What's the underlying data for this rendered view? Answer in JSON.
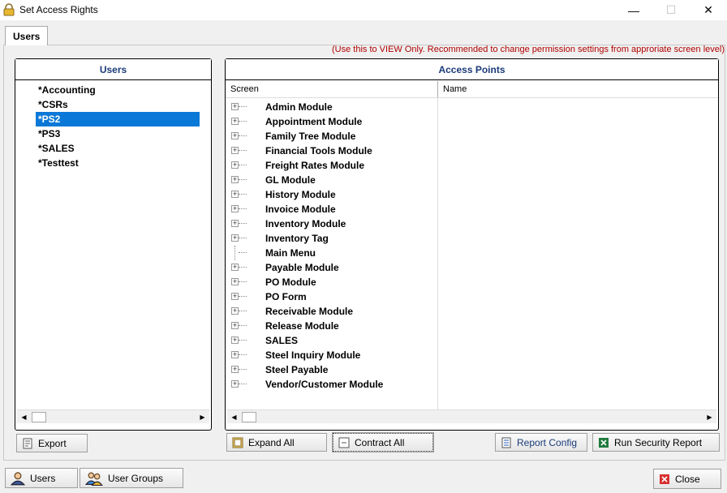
{
  "window": {
    "title": "Set Access Rights",
    "minimize": "—",
    "maximize": "☐",
    "close": "✕"
  },
  "tab": {
    "label": "Users"
  },
  "notice": "(Use this to VIEW Only. Recommended to change permission settings from approriate screen level)",
  "users_panel": {
    "title": "Users",
    "items": [
      "*Accounting",
      "*CSRs",
      "*PS2",
      "*PS3",
      "*SALES",
      "*Testtest"
    ],
    "selected": "*PS2"
  },
  "access_panel": {
    "title": "Access Points",
    "columns": [
      "Screen",
      "Name"
    ],
    "modules": [
      {
        "label": "Admin Module",
        "expandable": true
      },
      {
        "label": "Appointment Module",
        "expandable": true
      },
      {
        "label": "Family Tree Module",
        "expandable": true
      },
      {
        "label": "Financial Tools Module",
        "expandable": true
      },
      {
        "label": "Freight Rates Module",
        "expandable": true
      },
      {
        "label": "GL Module",
        "expandable": true
      },
      {
        "label": "History Module",
        "expandable": true
      },
      {
        "label": "Invoice Module",
        "expandable": true
      },
      {
        "label": "Inventory Module",
        "expandable": true
      },
      {
        "label": "Inventory Tag",
        "expandable": true
      },
      {
        "label": "Main Menu",
        "expandable": false
      },
      {
        "label": "Payable Module",
        "expandable": true
      },
      {
        "label": "PO Module",
        "expandable": true
      },
      {
        "label": "PO Form",
        "expandable": true
      },
      {
        "label": "Receivable Module",
        "expandable": true
      },
      {
        "label": "Release Module",
        "expandable": true
      },
      {
        "label": "SALES",
        "expandable": true
      },
      {
        "label": "Steel Inquiry Module",
        "expandable": true
      },
      {
        "label": "Steel Payable",
        "expandable": true
      },
      {
        "label": "Vendor/Customer Module",
        "expandable": true
      }
    ]
  },
  "buttons": {
    "export": "Export",
    "expand_all": "Expand All",
    "contract_all": "Contract All",
    "report_config": "Report Config",
    "run_security_report": "Run Security Report",
    "users": "Users",
    "user_groups": "User Groups",
    "close": "Close"
  },
  "colors": {
    "selection": "#0a78d7",
    "panel_title": "#1a3a78",
    "notice": "#b00000"
  }
}
